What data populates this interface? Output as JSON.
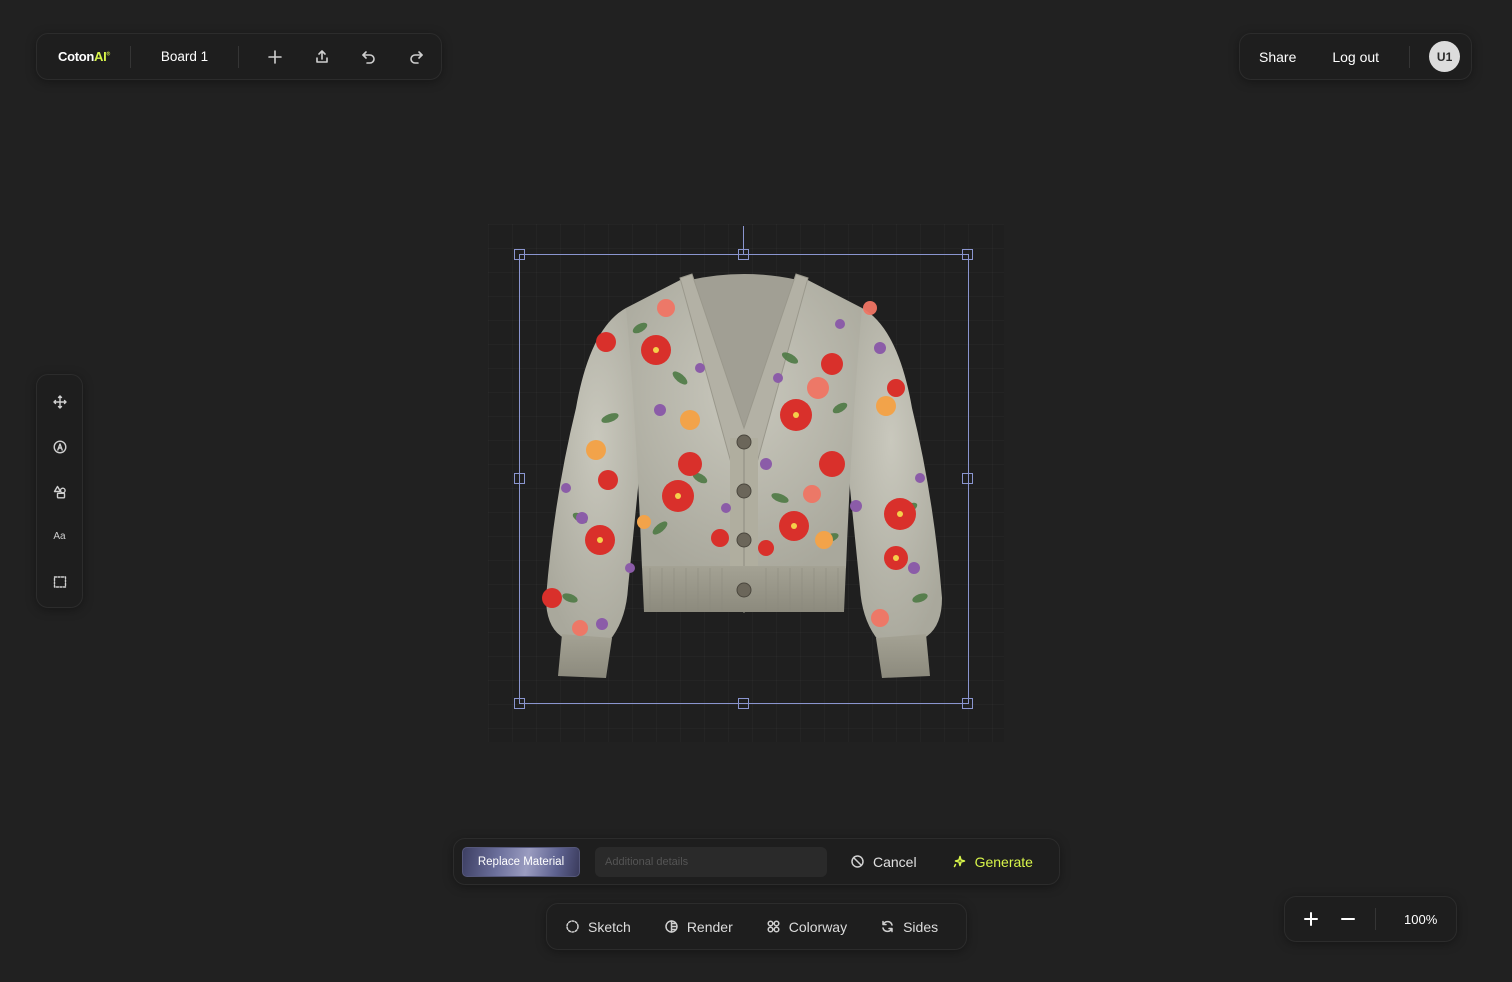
{
  "brand": {
    "name": "Coton",
    "ai": "AI",
    "mark": "®"
  },
  "board": {
    "title": "Board 1"
  },
  "toolbar": {
    "icons": [
      "add-icon",
      "export-icon",
      "undo-icon",
      "redo-icon"
    ]
  },
  "account": {
    "share_label": "Share",
    "logout_label": "Log out",
    "avatar_initials": "U1"
  },
  "left_tools": {
    "items": [
      {
        "name": "move-tool",
        "icon": "move-icon"
      },
      {
        "name": "pen-tool",
        "icon": "pen-circle-icon"
      },
      {
        "name": "shapes-tool",
        "icon": "shapes-icon"
      },
      {
        "name": "text-tool",
        "label": "Aa"
      },
      {
        "name": "select-tool",
        "icon": "marquee-icon"
      }
    ]
  },
  "prompt_bar": {
    "material_label": "Replace Material",
    "details_placeholder": "Additional details",
    "details_value": "",
    "cancel_label": "Cancel",
    "generate_label": "Generate"
  },
  "mode_bar": {
    "sketch_label": "Sketch",
    "render_label": "Render",
    "colorway_label": "Colorway",
    "sides_label": "Sides"
  },
  "zoom": {
    "level": "100%"
  },
  "colors": {
    "background": "#212121",
    "panel": "#1e1e1e",
    "accent": "#d8f54a",
    "selection": "#8a95cf"
  }
}
